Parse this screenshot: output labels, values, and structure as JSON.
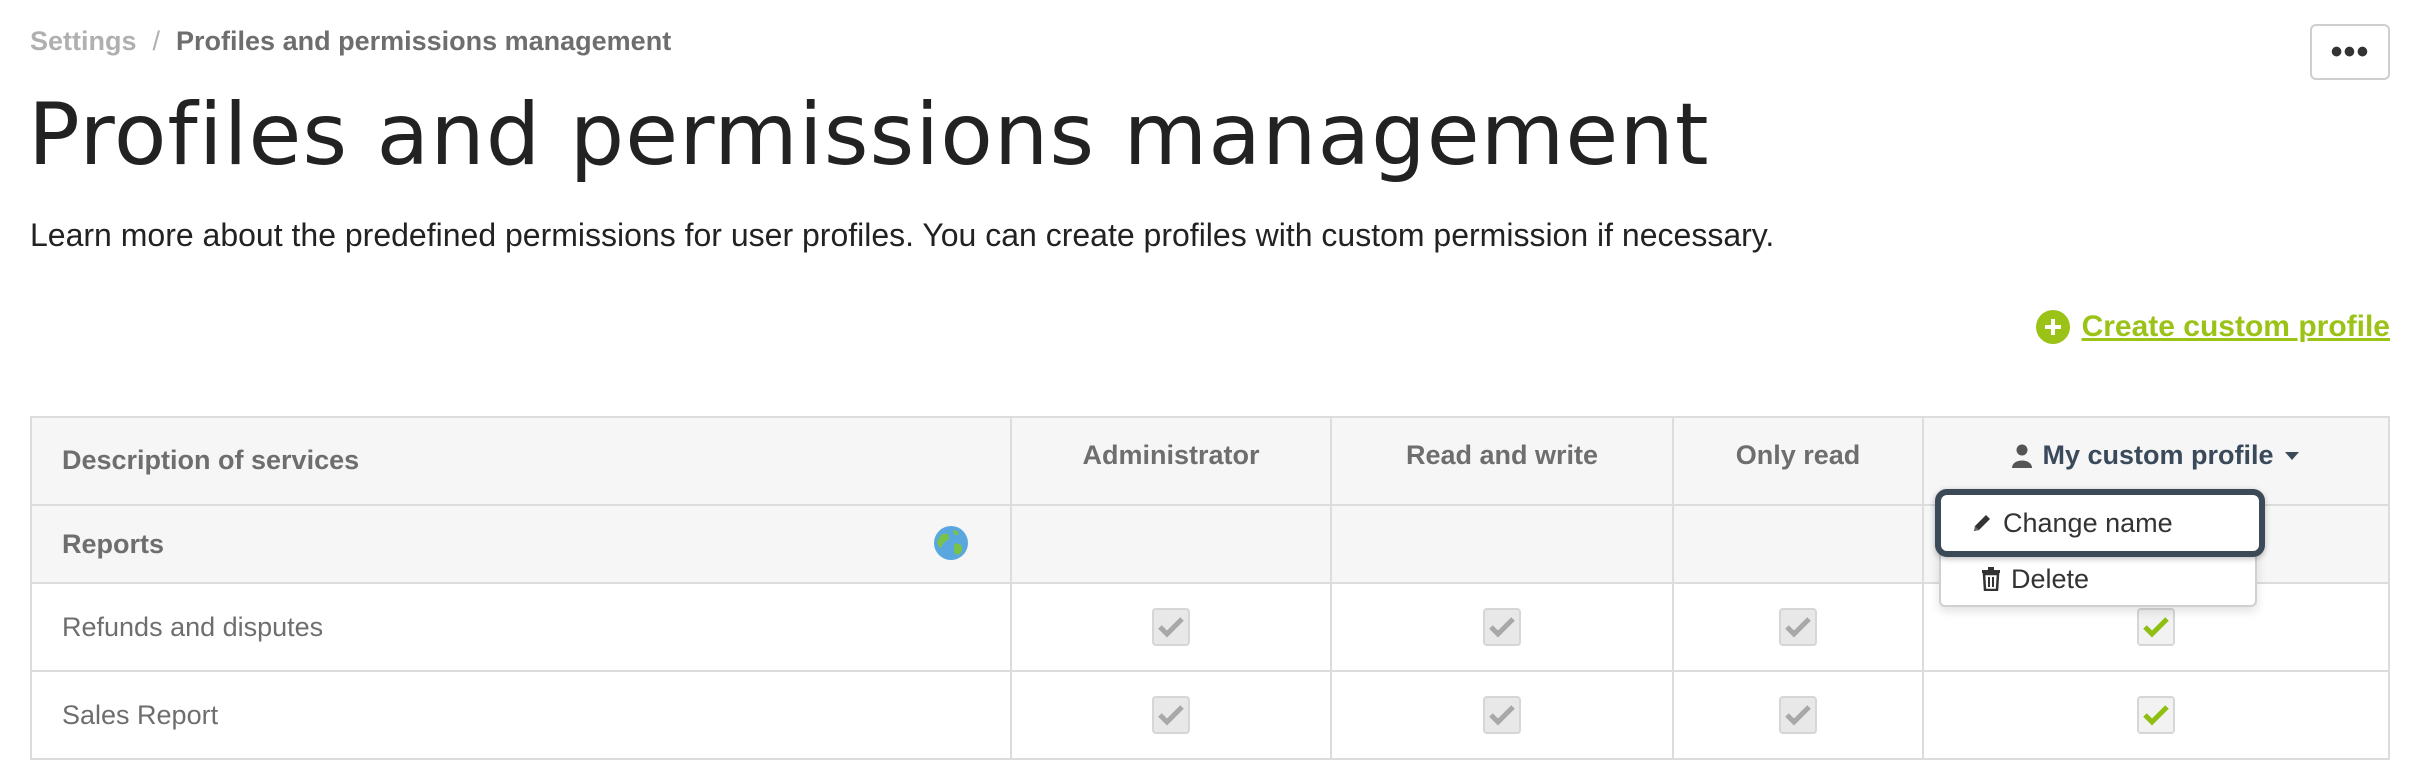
{
  "breadcrumb": {
    "root": "Settings",
    "separator": "/",
    "current": "Profiles and permissions management"
  },
  "header": {
    "more_label": "•••"
  },
  "page": {
    "title": "Profiles and permissions management",
    "subtitle": "Learn more about the predefined permissions for user profiles. You can create profiles with custom permission if necessary."
  },
  "actions": {
    "create_label": "Create custom profile"
  },
  "table": {
    "headers": {
      "description": "Description of services",
      "administrator": "Administrator",
      "read_write": "Read and write",
      "only_read": "Only read",
      "custom": "My custom profile"
    },
    "section": {
      "label": "Reports"
    },
    "rows": [
      {
        "label": "Refunds and disputes",
        "administrator": true,
        "read_write": true,
        "only_read": true,
        "custom": true
      },
      {
        "label": "Sales Report",
        "administrator": true,
        "read_write": true,
        "only_read": true,
        "custom": true
      }
    ]
  },
  "dropdown": {
    "change_name": "Change name",
    "delete": "Delete"
  },
  "colors": {
    "accent": "#9bc217",
    "focus_border": "#3c4a58",
    "check_grey": "#a8a8a8"
  }
}
